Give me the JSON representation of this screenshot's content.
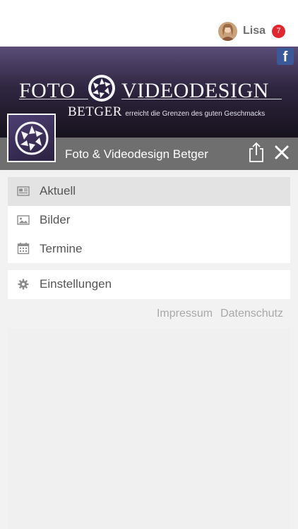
{
  "user": {
    "name": "Lisa",
    "notifications": "7"
  },
  "banner": {
    "title_left": "FOTO",
    "title_right": "VIDEODESIGN",
    "sub_name": "BETGER",
    "tagline": "erreicht die Grenzen des guten Geschmacks",
    "facebook_glyph": "f"
  },
  "header": {
    "title": "Foto & Videodesign Betger"
  },
  "menu": {
    "items": [
      {
        "label": "Aktuell",
        "icon": "newspaper-icon",
        "active": true
      },
      {
        "label": "Bilder",
        "icon": "image-icon",
        "active": false
      },
      {
        "label": "Termine",
        "icon": "calendar-icon",
        "active": false
      }
    ],
    "settings": {
      "label": "Einstellungen",
      "icon": "gear-icon"
    }
  },
  "footer": {
    "impressum": "Impressum",
    "datenschutz": "Datenschutz"
  },
  "colors": {
    "header_bar": "#6f6f6f",
    "badge": "#e0262f",
    "banner_top": "#5a4d78",
    "banner_bottom": "#16121d",
    "facebook": "#3b5998"
  }
}
